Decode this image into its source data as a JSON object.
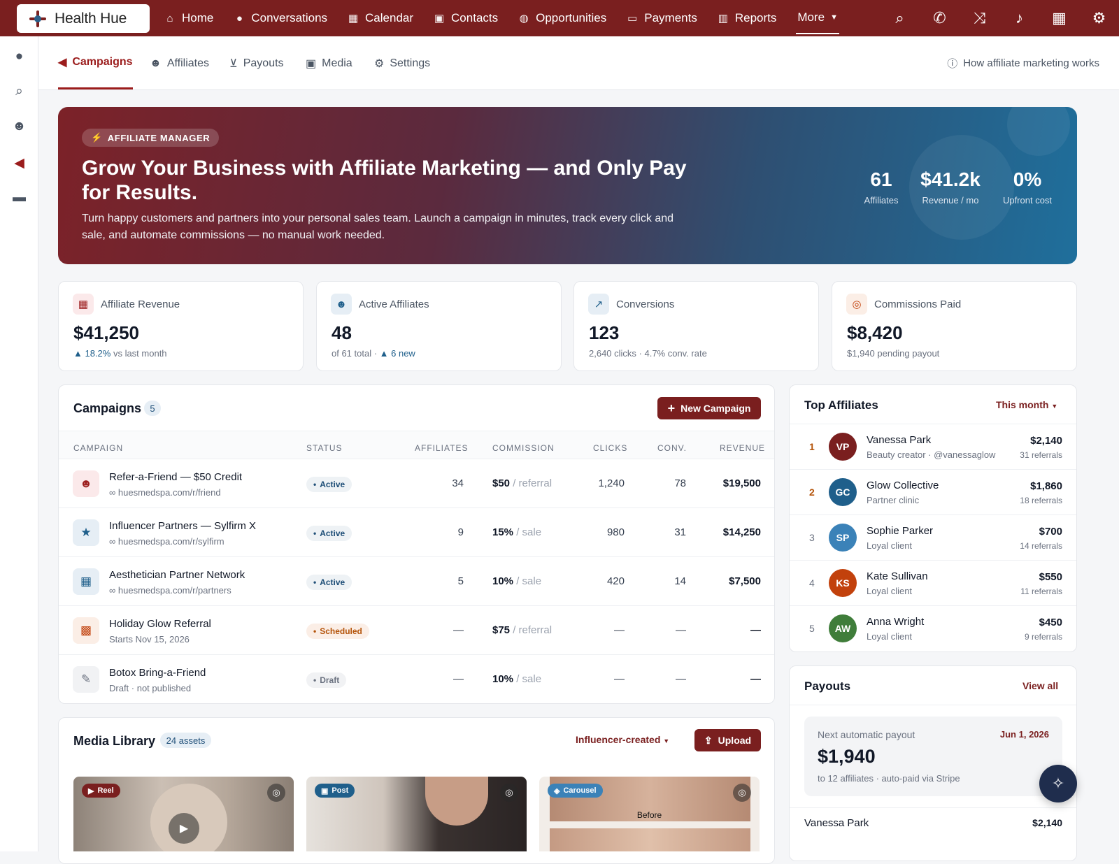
{
  "app": {
    "name": "Health Hue"
  },
  "topnav": {
    "items": [
      {
        "label": "Home",
        "icon": "home-icon"
      },
      {
        "label": "Conversations",
        "icon": "chat-icon"
      },
      {
        "label": "Calendar",
        "icon": "calendar-icon"
      },
      {
        "label": "Contacts",
        "icon": "contacts-icon"
      },
      {
        "label": "Opportunities",
        "icon": "lightbulb-icon"
      },
      {
        "label": "Payments",
        "icon": "card-icon"
      },
      {
        "label": "Reports",
        "icon": "chart-icon"
      }
    ],
    "more": "More"
  },
  "subnav": {
    "tabs": [
      "Campaigns",
      "Affiliates",
      "Payouts",
      "Media",
      "Settings"
    ],
    "active": "Campaigns",
    "help": "How affiliate marketing works"
  },
  "hero": {
    "badge": "AFFILIATE MANAGER",
    "title": "Grow Your Business with Affiliate Marketing — and Only Pay for Results.",
    "body": "Turn happy customers and partners into your personal sales team. Launch a campaign in minutes, track every click and sale, and automate commissions — no manual work needed.",
    "stats": [
      {
        "value": "61",
        "label": "Affiliates"
      },
      {
        "value": "$41.2k",
        "label": "Revenue / mo"
      },
      {
        "value": "0%",
        "label": "Upfront cost"
      }
    ]
  },
  "kpis": [
    {
      "label": "Affiliate Revenue",
      "value": "$41,250",
      "sub_up": "▲ 18.2%",
      "sub": " vs last month",
      "icon": "store-icon",
      "tint": "#fbe9ea",
      "iconColor": "#9b1c1c"
    },
    {
      "label": "Active Affiliates",
      "value": "48",
      "sub_pre": "of 61 total · ",
      "sub_up": "▲ 6 new",
      "icon": "users-icon",
      "tint": "#e6eef5",
      "iconColor": "#1f5f8b"
    },
    {
      "label": "Conversions",
      "value": "123",
      "sub": "2,640 clicks · 4.7% conv. rate",
      "icon": "trend-icon",
      "tint": "#e6eef5",
      "iconColor": "#1f5f8b"
    },
    {
      "label": "Commissions Paid",
      "value": "$8,420",
      "sub": "$1,940 pending payout",
      "icon": "coins-icon",
      "tint": "#fbeee6",
      "iconColor": "#c2410c"
    }
  ],
  "campaigns": {
    "title": "Campaigns",
    "count": "5",
    "new_button": "New Campaign",
    "headers": [
      "CAMPAIGN",
      "STATUS",
      "AFFILIATES",
      "COMMISSION",
      "CLICKS",
      "CONV.",
      "REVENUE"
    ],
    "rows": [
      {
        "name": "Refer-a-Friend — $50 Credit",
        "sub": "huesmedspa.com/r/friend",
        "link": true,
        "status": "Active",
        "affiliates": "34",
        "commission": "$50",
        "unit": " / referral",
        "clicks": "1,240",
        "conv": "78",
        "revenue": "$19,500",
        "icon": "users-icon"
      },
      {
        "name": "Influencer Partners — Sylfirm X",
        "sub": "huesmedspa.com/r/sylfirm",
        "link": true,
        "status": "Active",
        "affiliates": "9",
        "commission": "15%",
        "unit": " / sale",
        "clicks": "980",
        "conv": "31",
        "revenue": "$14,250",
        "icon": "star-icon"
      },
      {
        "name": "Aesthetician Partner Network",
        "sub": "huesmedspa.com/r/partners",
        "link": true,
        "status": "Active",
        "affiliates": "5",
        "commission": "10%",
        "unit": " / sale",
        "clicks": "420",
        "conv": "14",
        "revenue": "$7,500",
        "icon": "store-icon"
      },
      {
        "name": "Holiday Glow Referral",
        "sub": "Starts Nov 15, 2026",
        "link": false,
        "status": "Scheduled",
        "affiliates": "—",
        "commission": "$75",
        "unit": " / referral",
        "clicks": "—",
        "conv": "—",
        "revenue": "—",
        "icon": "gift-icon"
      },
      {
        "name": "Botox Bring-a-Friend",
        "sub": "Draft · not published",
        "link": false,
        "status": "Draft",
        "affiliates": "—",
        "commission": "10%",
        "unit": " / sale",
        "clicks": "—",
        "conv": "—",
        "revenue": "—",
        "icon": "syringe-icon"
      }
    ]
  },
  "top_affiliates": {
    "title": "Top Affiliates",
    "filter": "This month",
    "rows": [
      {
        "rank": "1",
        "initials": "VP",
        "name": "Vanessa Park",
        "sub": "Beauty creator · @vanessaglow",
        "amount": "$2,140",
        "refs": "31 referrals",
        "color": "#7a1f1f"
      },
      {
        "rank": "2",
        "initials": "GC",
        "name": "Glow Collective",
        "sub": "Partner clinic",
        "amount": "$1,860",
        "refs": "18 referrals",
        "color": "#1f5f8b"
      },
      {
        "rank": "3",
        "initials": "SP",
        "name": "Sophie Parker",
        "sub": "Loyal client",
        "amount": "$700",
        "refs": "14 referrals",
        "color": "#3b82b8"
      },
      {
        "rank": "4",
        "initials": "KS",
        "name": "Kate Sullivan",
        "sub": "Loyal client",
        "amount": "$550",
        "refs": "11 referrals",
        "color": "#c2410c"
      },
      {
        "rank": "5",
        "initials": "AW",
        "name": "Anna Wright",
        "sub": "Loyal client",
        "amount": "$450",
        "refs": "9 referrals",
        "color": "#3f7d3a"
      }
    ]
  },
  "payouts": {
    "title": "Payouts",
    "view_all": "View all",
    "next_label": "Next automatic payout",
    "next_date": "Jun 1, 2026",
    "next_amount": "$1,940",
    "next_sub": "to 12 affiliates · auto-paid via Stripe",
    "first_name": "Vanessa Park",
    "first_amount": "$2,140"
  },
  "media": {
    "title": "Media Library",
    "count": "24 assets",
    "filter": "Influencer-created",
    "upload": "Upload",
    "items": [
      {
        "tag": "Reel",
        "tagColor": "#7a1f1f"
      },
      {
        "tag": "Post",
        "tagColor": "#1f5f8b"
      },
      {
        "tag": "Carousel",
        "tagColor": "#3b82b8",
        "caption": "Before"
      }
    ]
  }
}
